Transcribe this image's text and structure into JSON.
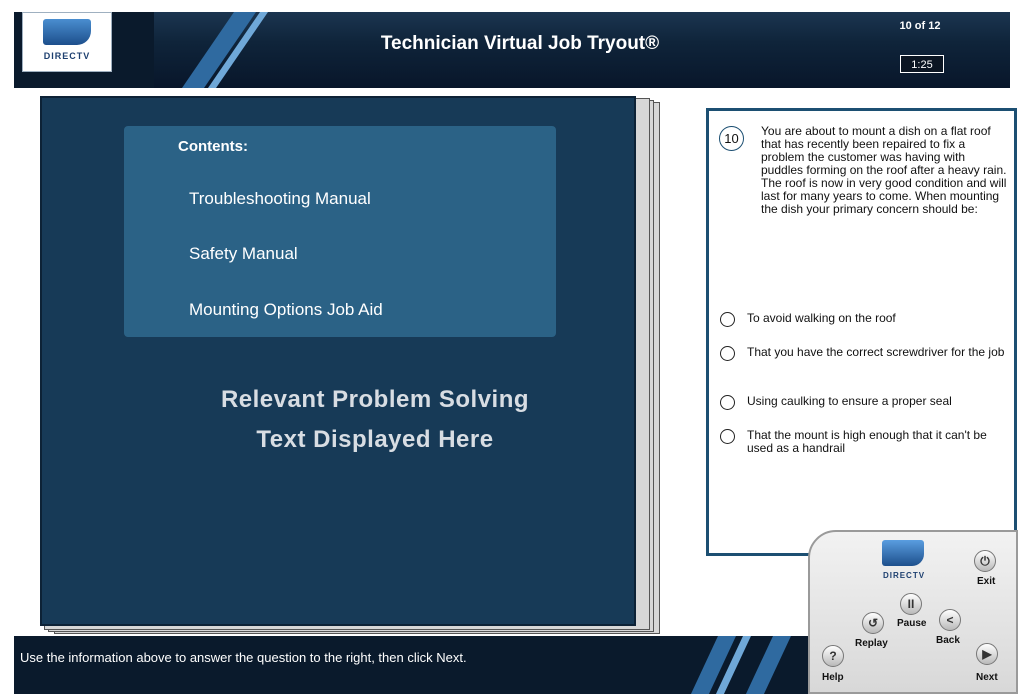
{
  "header": {
    "logo_text": "DIRECTV",
    "title": "Technician Virtual Job Tryout®",
    "progress": "10 of 12",
    "timer": "1:25"
  },
  "book": {
    "contents_title": "Contents:",
    "items": [
      {
        "label": "Troubleshooting Manual"
      },
      {
        "label": "Safety Manual"
      },
      {
        "label": "Mounting Options Job Aid"
      }
    ],
    "relevant_line1": "Relevant Problem Solving",
    "relevant_line2": "Text Displayed Here"
  },
  "question": {
    "number": "10",
    "text": "You are about to mount a dish on a flat roof that has recently been repaired to fix a problem the customer was having with puddles forming on the roof after a heavy rain. The roof is now in very good condition and will last for many years to come. When mounting the dish your primary concern should be:",
    "options": [
      {
        "label": "To avoid walking on the roof"
      },
      {
        "label": "That you have the correct screwdriver for the job"
      },
      {
        "label": "Using caulking to ensure a proper seal"
      },
      {
        "label": "That the mount is high enough that it can't be used as a handrail"
      }
    ]
  },
  "footer": {
    "instruction": "Use the information above to answer the question to the right, then click Next."
  },
  "controller": {
    "logo_text": "DIRECTV",
    "exit_label": "Exit",
    "pause_label": "Pause",
    "replay_label": "Replay",
    "back_label": "Back",
    "help_label": "Help",
    "next_label": "Next",
    "help_glyph": "?",
    "pause_glyph": "II",
    "replay_glyph": "↺",
    "back_glyph": "<",
    "next_glyph": "▶",
    "exit_glyph": "⏻"
  },
  "colors": {
    "header_bg": "#0a1a2c",
    "book_bg": "#173a57",
    "contents_bg": "#2b6286",
    "question_border": "#1c4f72",
    "accent_stripe": "#4a8ed0"
  }
}
